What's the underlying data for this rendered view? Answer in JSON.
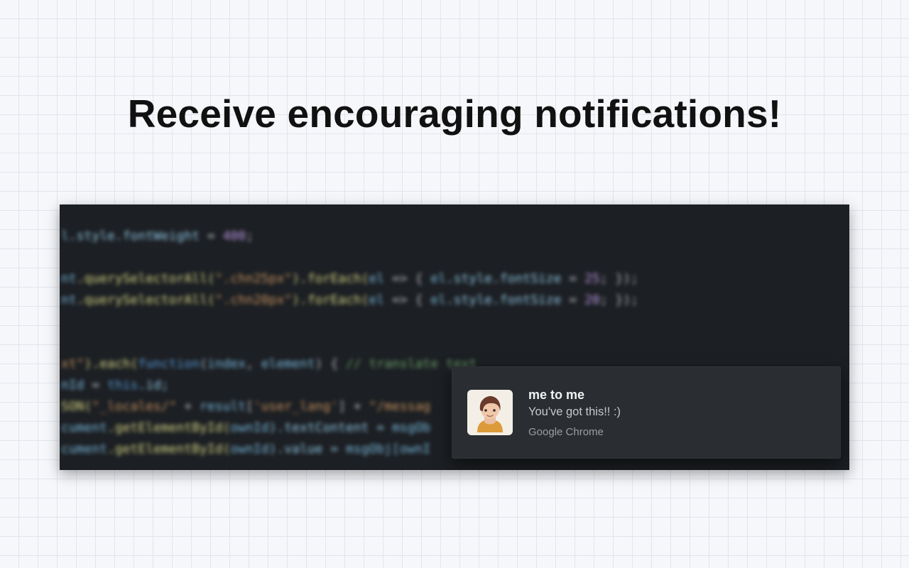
{
  "headline": "Receive encouraging notifications!",
  "code": {
    "line1_a": "l",
    "line1_b": ".style.fontWeight",
    "line1_c": " = ",
    "line1_d": "400",
    "line1_e": ";",
    "line3_a": "nt",
    "line3_b": ".querySelectorAll(",
    "line3_c": "\".chn25px\"",
    "line3_d": ").forEach(",
    "line3_e": "el",
    "line3_f": " => { ",
    "line3_g": "el",
    "line3_h": ".style.fontSize",
    "line3_i": " = ",
    "line3_j": "25",
    "line3_k": "; });",
    "line4_a": "nt",
    "line4_b": ".querySelectorAll(",
    "line4_c": "\".chn20px\"",
    "line4_d": ").forEach(",
    "line4_e": "el",
    "line4_f": " => { ",
    "line4_g": "el",
    "line4_h": ".style.fontSize",
    "line4_i": " = ",
    "line4_j": "20",
    "line4_k": "; });",
    "line6_a": "xt\"",
    "line6_b": ").each(",
    "line6_c": "function",
    "line6_d": "(",
    "line6_e": "index",
    "line6_f": ", ",
    "line6_g": "element",
    "line6_h": ") { ",
    "line6_i": "// translate text",
    "line7_a": "nId",
    "line7_b": " = ",
    "line7_c": "this",
    "line7_d": ".id;",
    "line8_a": "SON(",
    "line8_b": "\"_locales/\"",
    "line8_c": " + ",
    "line8_d": "result",
    "line8_e": "[",
    "line8_f": "'user_lang'",
    "line8_g": "] + ",
    "line8_h": "\"/messag",
    "line9_a": "cument",
    "line9_b": ".getElementById(",
    "line9_c": "ownId",
    "line9_d": ").textContent = ",
    "line9_e": "msgOb",
    "line10_a": "cument",
    "line10_b": ".getElementById(",
    "line10_c": "ownId",
    "line10_d": ").value = ",
    "line10_e": "msgObj[ownI"
  },
  "notification": {
    "title": "me to me",
    "body": "You've got this!! :)",
    "source": "Google Chrome"
  }
}
